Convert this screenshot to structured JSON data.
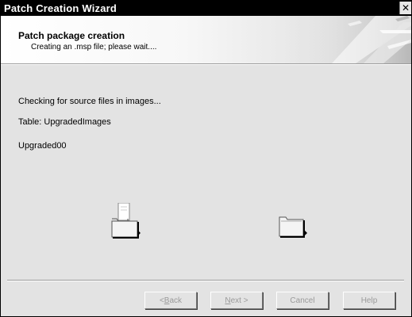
{
  "window": {
    "title": "Patch Creation Wizard",
    "close_glyph": "✕"
  },
  "header": {
    "title": "Patch package creation",
    "subtitle": "Creating an .msp file; please wait...."
  },
  "status": {
    "line1": "Checking for source files in images...",
    "line2": "Table: UpgradedImages",
    "line3": "Upgraded00"
  },
  "buttons": {
    "back": {
      "key": "B",
      "rest": "ack",
      "prefix": "< "
    },
    "next": {
      "key": "N",
      "rest": "ext >"
    },
    "cancel": "Cancel",
    "help": "Help"
  },
  "icons": {
    "source_folder": "folder-with-document-icon",
    "destination_folder": "folder-icon"
  }
}
